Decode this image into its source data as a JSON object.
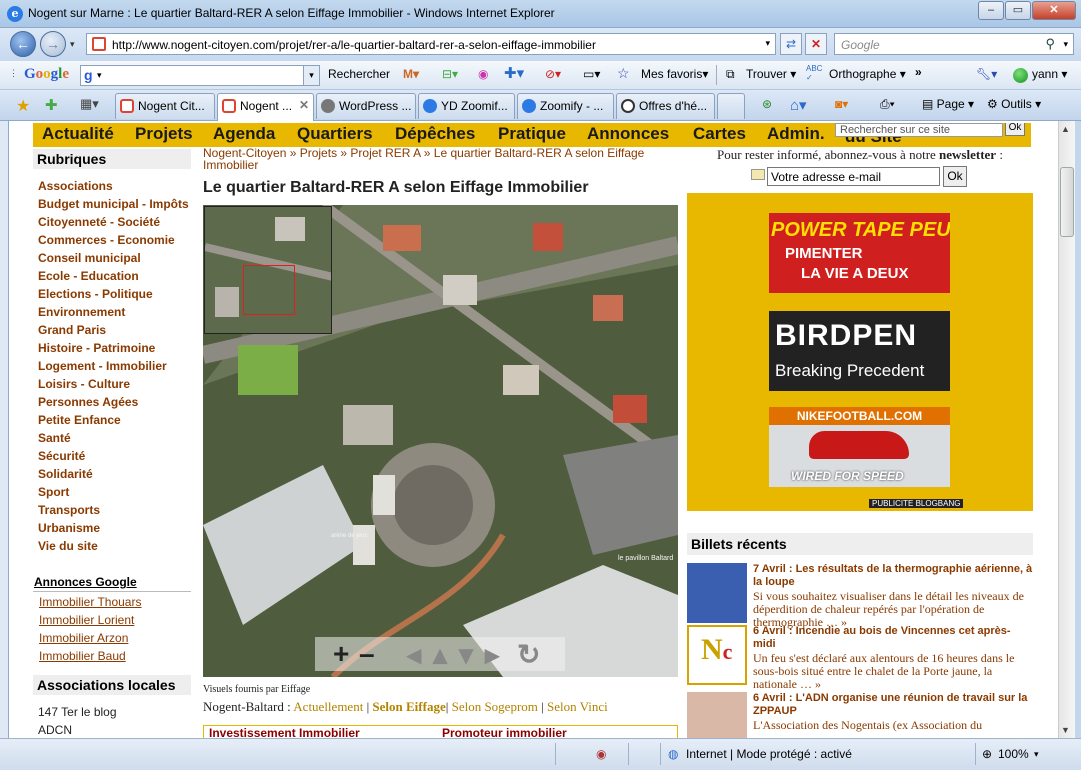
{
  "window": {
    "title": "Nogent sur Marne : Le quartier Baltard-RER A selon Eiffage Immobilier - Windows Internet Explorer"
  },
  "address": {
    "url": "http://www.nogent-citoyen.com/projet/rer-a/le-quartier-baltard-rer-a-selon-eiffage-immobilier",
    "search_placeholder": "Google"
  },
  "google_toolbar": {
    "logo": "Google",
    "input_value": "g",
    "search_label": "Rechercher",
    "favorites_label": "Mes favoris",
    "find_label": "Trouver",
    "spelling_label": "Orthographe",
    "more": "»",
    "user": "yann"
  },
  "tabs": [
    {
      "label": "Nogent Cit..."
    },
    {
      "label": "Nogent ..."
    },
    {
      "label": "WordPress ..."
    },
    {
      "label": "YD Zoomif..."
    },
    {
      "label": "Zoomify - ..."
    },
    {
      "label": "Offres d'hé..."
    }
  ],
  "command_bar": {
    "page_label": "Page",
    "tools_label": "Outils"
  },
  "site": {
    "nav": [
      "Actualité",
      "Projets",
      "Agenda",
      "Quartiers",
      "Dépêches",
      "Pratique",
      "Annonces",
      "Cartes",
      "Admin."
    ],
    "nav_search_label": "du Site",
    "nav_search_placeholder": "Rechercher sur ce site",
    "nav_ok": "Ok",
    "rubriques_title": "Rubriques",
    "rubriques": [
      "Associations",
      "Budget municipal - Impôts",
      "Citoyenneté - Société",
      "Commerces - Economie",
      "Conseil municipal",
      "Ecole - Education",
      "Elections - Politique",
      "Environnement",
      "Grand Paris",
      "Histoire - Patrimoine",
      "Logement - Immobilier",
      "Loisirs - Culture",
      "Personnes Agées",
      "Petite Enfance",
      "Santé",
      "Sécurité",
      "Solidarité",
      "Sport",
      "Transports",
      "Urbanisme",
      "Vie du site"
    ],
    "annonces_title": "Annonces Google",
    "annonces": [
      "Immobilier Thouars",
      "Immobilier Lorient",
      "Immobilier Arzon",
      "Immobilier Baud"
    ],
    "assoc_title": "Associations locales",
    "assoc": [
      "147 Ter le blog",
      "ADCN"
    ],
    "breadcrumb": "Nogent-Citoyen » Projets » Projet RER A » Le quartier Baltard-RER A selon Eiffage Immobilier",
    "article_title": "Le quartier Baltard-RER A selon Eiffage Immobilier",
    "map_labels": {
      "pavilion": "le pavillon Baltard",
      "lawn": "arène de jeux"
    },
    "caption": "Visuels fournis par Eiffage",
    "links_prefix": "Nogent-Baltard :",
    "links": [
      "Actuellement",
      "Selon Eiffage",
      "Selon Sogeprom",
      "Selon Vinci"
    ],
    "bottom_labels": [
      "Investissement Immobilier",
      "Promoteur immobilier"
    ],
    "newsletter_text": "Pour rester informé, abonnez-vous à notre",
    "newsletter_bold": "newsletter",
    "newsletter_colon": " :",
    "email_placeholder": "Votre adresse e-mail",
    "email_ok": "Ok",
    "ads": {
      "ad1_line1": "POWER TAPE PEUT",
      "ad1_line2": "PIMENTER",
      "ad1_line3": "LA VIE A DEUX",
      "ad2_line1": "BIRDPEN",
      "ad2_line2": "Breaking Precedent",
      "ad3_line1": "NIKEFOOTBALL.COM",
      "ad3_line2": "WIRED FOR SPEED",
      "publicite": "PUBLICITE BLOGBANG"
    },
    "billets_title": "Billets récents",
    "billets": [
      {
        "head": "7 Avril : Les résultats de la thermographie aérienne, à la loupe",
        "text": "Si vous souhaitez visualiser dans le détail les niveaux de déperdition de chaleur repérés par l'opération de thermographie … »"
      },
      {
        "head": "6 Avril : Incendie au bois de Vincennes cet après-midi",
        "text": "Un feu s'est déclaré aux alentours de 16 heures dans le sous-bois situé entre le chalet de la Porte jaune, la nationale … »"
      },
      {
        "head": "6 Avril : L'ADN organise une réunion de travail sur la ZPPAUP",
        "text": "L'Association des Nogentais (ex Association du"
      }
    ]
  },
  "status": {
    "zone": "Internet | Mode protégé : activé",
    "zoom": "100%"
  }
}
